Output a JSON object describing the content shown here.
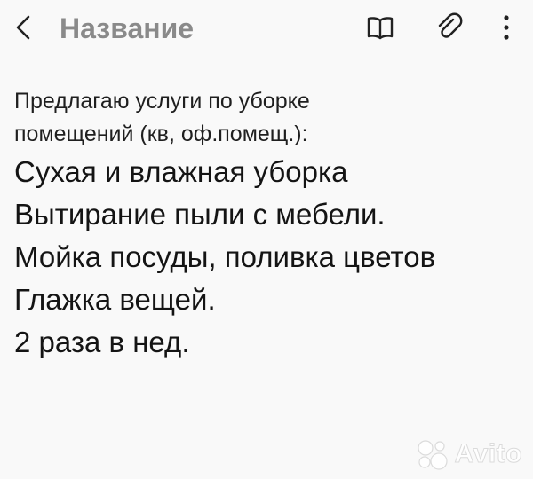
{
  "toolbar": {
    "back_icon": "chevron-left-icon",
    "title": "Название",
    "read_mode_icon": "book-open-icon",
    "attach_icon": "paperclip-icon",
    "more_icon": "more-vertical-icon"
  },
  "note": {
    "lines": [
      "Предлагаю услуги по уборке",
      "помещений (кв, оф.помещ.):",
      "Сухая и влажная уборка",
      "Вытирание пыли с мебели.",
      "Мойка посуды, поливка цветов",
      "Глажка вещей.",
      "2 раза в нед."
    ]
  },
  "watermark": {
    "text": "Avito"
  },
  "colors": {
    "background": "#f9f9f9",
    "title": "#8a8a8a",
    "text": "#1a1a1a"
  }
}
